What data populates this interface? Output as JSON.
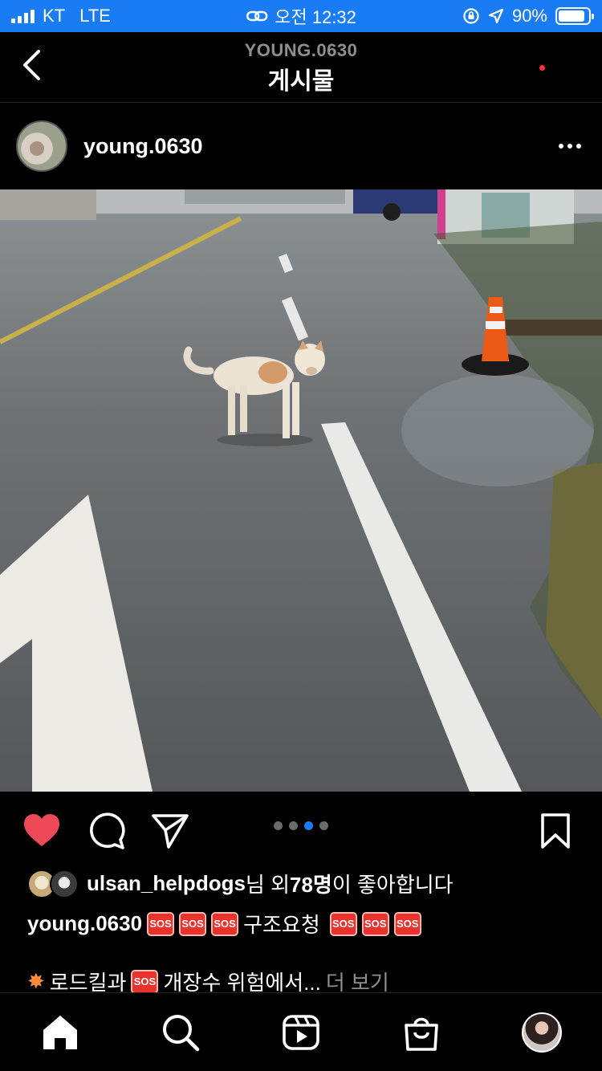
{
  "status_bar": {
    "carrier": "KT",
    "network": "LTE",
    "time": "오전 12:32",
    "battery": "90%",
    "battery_level": 0.9
  },
  "header": {
    "account": "YOUNG.0630",
    "title": "게시물"
  },
  "post": {
    "username": "young.0630",
    "carousel": {
      "total": 4,
      "active_index": 2
    },
    "likes": {
      "user": "ulsan_helpdogs",
      "suffix1": "님 외 ",
      "count": "78명",
      "suffix2": "이 좋아합니다"
    },
    "caption": {
      "username": "young.0630",
      "sos_label": "SOS",
      "text": "구조요청"
    },
    "caption_line2": {
      "text_before": "로드킬과",
      "text_after": "개장수 위험에서...",
      "more": "더 보기"
    }
  },
  "icons": {
    "back": "chevron-left-icon",
    "more": "more-horizontal-icon",
    "like": "heart-icon",
    "comment": "comment-icon",
    "share": "send-icon",
    "save": "bookmark-icon",
    "home": "home-icon",
    "search": "search-icon",
    "reels": "reels-icon",
    "shop": "shop-bag-icon"
  },
  "colors": {
    "accent": "#1a7cf5",
    "like": "#ed4956",
    "sos": "#e8322b"
  }
}
